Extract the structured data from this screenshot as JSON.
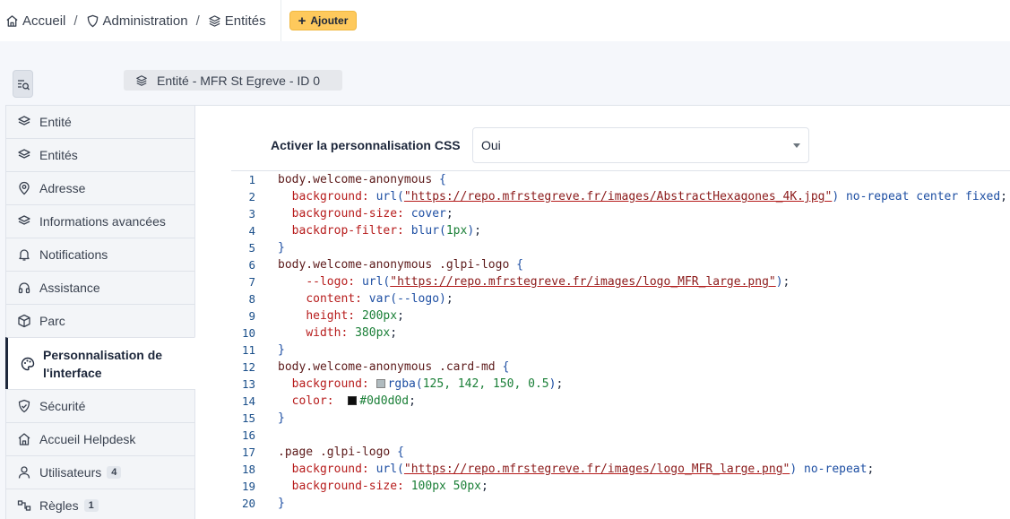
{
  "breadcrumb": {
    "home": "Accueil",
    "admin": "Administration",
    "entities": "Entités",
    "separator": "/"
  },
  "toolbar": {
    "add_label": "Ajouter",
    "add_icon": "plus-icon"
  },
  "entity_badge": "Entité -  MFR St Egreve - ID 0",
  "tabs": [
    {
      "label": "Entité",
      "icon": "layers-icon"
    },
    {
      "label": "Entités",
      "icon": "layers-icon"
    },
    {
      "label": "Adresse",
      "icon": "map-pin-icon"
    },
    {
      "label": "Informations avancées",
      "icon": "layers-icon"
    },
    {
      "label": "Notifications",
      "icon": "bell-icon"
    },
    {
      "label": "Assistance",
      "icon": "headset-icon"
    },
    {
      "label": "Parc",
      "icon": "box-icon"
    },
    {
      "label": "Personnalisation de l'interface",
      "icon": "palette-icon",
      "active": true
    },
    {
      "label": "Sécurité",
      "icon": "shield-icon"
    },
    {
      "label": "Accueil Helpdesk",
      "icon": "home-icon"
    },
    {
      "label": "Utilisateurs",
      "icon": "user-icon",
      "count": "4"
    },
    {
      "label": "Règles",
      "icon": "rules-icon",
      "count": "1"
    }
  ],
  "form": {
    "css_label": "Activer la personnalisation CSS",
    "css_value": "Oui"
  },
  "code": {
    "line_numbers": [
      "1",
      "2",
      "3",
      "4",
      "5",
      "6",
      "7",
      "8",
      "9",
      "10",
      "11",
      "12",
      "13",
      "14",
      "15",
      "16",
      "17",
      "18",
      "19",
      "20"
    ],
    "url_bg": "\"https://repo.mfrstegreve.fr/images/AbstractHexagones_4K.jpg\"",
    "url_logo": "\"https://repo.mfrstegreve.fr/images/logo_MFR_large.png\"",
    "swatch_colors": [
      "#7d8e96",
      "#0d0d0d"
    ]
  }
}
